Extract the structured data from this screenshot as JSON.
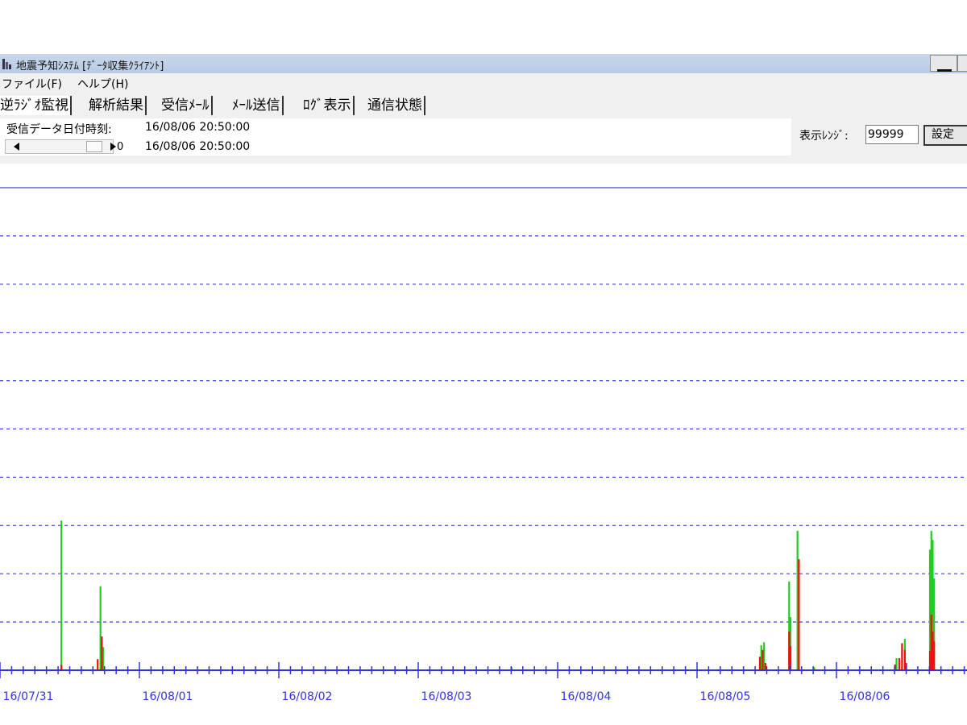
{
  "window": {
    "title": "地震予知ｼｽﾃﾑ [ﾃﾞｰﾀ収集ｸﾗｲｱﾝﾄ]"
  },
  "menu": {
    "items": [
      "ファイル(F)",
      "ヘルプ(H)"
    ]
  },
  "tabs": [
    {
      "label": "逆ﾗｼﾞｵ監視",
      "active": true
    },
    {
      "label": "解析結果",
      "active": false
    },
    {
      "label": "受信ﾒｰﾙ",
      "active": false
    },
    {
      "label": "ﾒｰﾙ送信",
      "active": false
    },
    {
      "label": "ﾛｸﾞ表示",
      "active": false
    },
    {
      "label": "通信状態",
      "active": false
    }
  ],
  "toolbar": {
    "received_label": "受信データ日付時刻:",
    "received_datetime": "16/08/06 20:50:00",
    "scroll_value": "0",
    "scroll_datetime": "16/08/06 20:50:00",
    "range_label": "表示ﾚﾝｼﾞ:",
    "range_value": "99999",
    "set_button_label": "設定"
  },
  "colors": {
    "axis": "#3333dd",
    "grid": "#4444cc",
    "series_green": "#22cc22",
    "series_red": "#ee1111"
  },
  "chart_data": {
    "type": "bar",
    "x_tick_labels": [
      "16/07/31",
      "16/08/01",
      "16/08/02",
      "16/08/03",
      "16/08/04",
      "16/08/05",
      "16/08/06"
    ],
    "x_range": [
      "16/07/31 00:00",
      "16/08/06 ~22:00"
    ],
    "y_range": [
      0,
      99999
    ],
    "y_gridlines": 10,
    "grid": true,
    "series": [
      {
        "color": "green",
        "points": [
          {
            "t": 0.44,
            "v": 31000
          },
          {
            "t": 0.72,
            "v": 17400
          },
          {
            "t": 0.74,
            "v": 4800
          },
          {
            "t": 3.67,
            "v": 600
          },
          {
            "t": 5.46,
            "v": 5200
          },
          {
            "t": 5.48,
            "v": 5800
          },
          {
            "t": 5.66,
            "v": 18400
          },
          {
            "t": 5.67,
            "v": 11000
          },
          {
            "t": 5.72,
            "v": 28900
          },
          {
            "t": 5.73,
            "v": 20000
          },
          {
            "t": 5.84,
            "v": 600
          },
          {
            "t": 6.43,
            "v": 2500
          },
          {
            "t": 6.47,
            "v": 5200
          },
          {
            "t": 6.49,
            "v": 6500
          },
          {
            "t": 6.67,
            "v": 25000
          },
          {
            "t": 6.68,
            "v": 28900
          },
          {
            "t": 6.69,
            "v": 27000
          },
          {
            "t": 6.7,
            "v": 19000
          }
        ]
      },
      {
        "color": "red",
        "points": [
          {
            "t": 0.44,
            "v": 1100
          },
          {
            "t": 0.7,
            "v": 2300
          },
          {
            "t": 0.73,
            "v": 7000
          },
          {
            "t": 5.45,
            "v": 2800
          },
          {
            "t": 5.47,
            "v": 4200
          },
          {
            "t": 5.49,
            "v": 1500
          },
          {
            "t": 5.66,
            "v": 8000
          },
          {
            "t": 5.67,
            "v": 5000
          },
          {
            "t": 5.73,
            "v": 23000
          },
          {
            "t": 6.42,
            "v": 1200
          },
          {
            "t": 6.45,
            "v": 2500
          },
          {
            "t": 6.47,
            "v": 5600
          },
          {
            "t": 6.49,
            "v": 4200
          },
          {
            "t": 6.5,
            "v": 1500
          },
          {
            "t": 6.67,
            "v": 4000
          },
          {
            "t": 6.68,
            "v": 11500
          },
          {
            "t": 6.69,
            "v": 8000
          },
          {
            "t": 6.7,
            "v": 6000
          }
        ]
      }
    ]
  }
}
